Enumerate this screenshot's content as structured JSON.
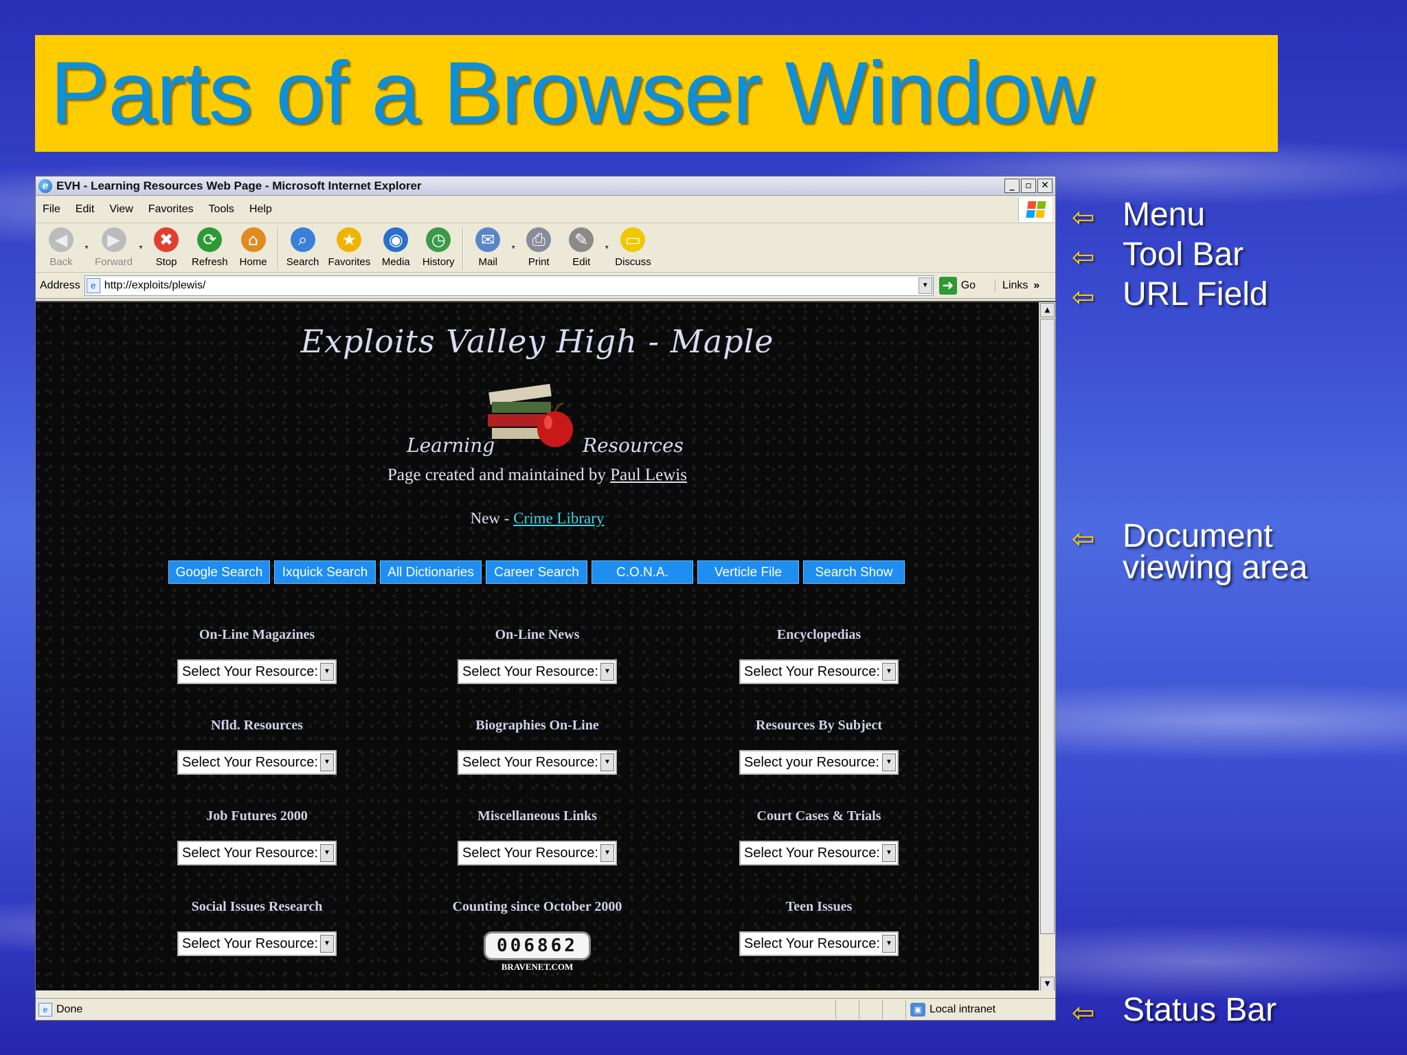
{
  "slide": {
    "title": "Parts of a Browser Window",
    "callouts": [
      {
        "label": "Menu"
      },
      {
        "label": "Tool Bar"
      },
      {
        "label": "URL Field"
      },
      {
        "label": "Document\nviewing area"
      },
      {
        "label": "Status Bar"
      }
    ]
  },
  "browser": {
    "window_title": "EVH - Learning Resources Web Page - Microsoft Internet Explorer",
    "window_buttons": [
      "_",
      "▫",
      "✕"
    ],
    "menu": [
      "File",
      "Edit",
      "View",
      "Favorites",
      "Tools",
      "Help"
    ],
    "toolbar": [
      {
        "label": "Back",
        "icon": "back-icon",
        "glyph": "◀",
        "color": "#bcbcbc",
        "disabled": true
      },
      {
        "label": "Forward",
        "icon": "forward-icon",
        "glyph": "▶",
        "color": "#bcbcbc",
        "disabled": true
      },
      {
        "label": "Stop",
        "icon": "stop-icon",
        "glyph": "✖",
        "color": "#e04030"
      },
      {
        "label": "Refresh",
        "icon": "refresh-icon",
        "glyph": "⟳",
        "color": "#2e9a36"
      },
      {
        "label": "Home",
        "icon": "home-icon",
        "glyph": "⌂",
        "color": "#e08a20"
      },
      {
        "label": "Search",
        "icon": "search-icon",
        "glyph": "⌕",
        "color": "#3b7fd8"
      },
      {
        "label": "Favorites",
        "icon": "favorites-star-icon",
        "glyph": "★",
        "color": "#f0b400"
      },
      {
        "label": "Media",
        "icon": "media-globe-icon",
        "glyph": "◉",
        "color": "#2a70c8"
      },
      {
        "label": "History",
        "icon": "history-clock-icon",
        "glyph": "◷",
        "color": "#3a9a48"
      },
      {
        "label": "Mail",
        "icon": "mail-icon",
        "glyph": "✉",
        "color": "#5a86c8"
      },
      {
        "label": "Print",
        "icon": "print-icon",
        "glyph": "⎙",
        "color": "#8a8a9a"
      },
      {
        "label": "Edit",
        "icon": "edit-icon",
        "glyph": "✎",
        "color": "#8a8a8a"
      },
      {
        "label": "Discuss",
        "icon": "discuss-icon",
        "glyph": "▭",
        "color": "#f0c800"
      }
    ],
    "address": {
      "label": "Address",
      "value": "http://exploits/plewis/",
      "go": "Go",
      "links": "Links",
      "links_chevron": "»"
    },
    "page": {
      "site_title": "Exploits Valley High - Maple",
      "logo_left": "Learning",
      "logo_right": "Resources",
      "maintained_prefix": "Page created and maintained by",
      "maintained_link": "Paul Lewis",
      "new_prefix": "New -",
      "new_link": "Crime Library",
      "nav_buttons": [
        "Google Search",
        "Ixquick Search",
        "All Dictionaries",
        "Career Search",
        "C.O.N.A.",
        "Verticle File",
        "Search Show"
      ],
      "resources": [
        {
          "label": "On-Line Magazines",
          "select": "Select Your Resource:"
        },
        {
          "label": "On-Line News",
          "select": "Select Your Resource:"
        },
        {
          "label": "Encyclopedias",
          "select": "Select Your Resource:"
        },
        {
          "label": "Nfld. Resources",
          "select": "Select Your Resource:"
        },
        {
          "label": "Biographies On-Line",
          "select": "Select Your Resource:"
        },
        {
          "label": "Resources By Subject",
          "select": "Select your Resource:"
        },
        {
          "label": "Job Futures 2000",
          "select": "Select Your Resource:"
        },
        {
          "label": "Miscellaneous Links",
          "select": "Select Your Resource:"
        },
        {
          "label": "Court Cases & Trials",
          "select": "Select Your Resource:"
        },
        {
          "label": "Social Issues Research",
          "select": "Select Your Resource:"
        },
        {
          "label": "Counting since October 2000",
          "counter": "006862",
          "counter_sub": "BRAVENET.COM"
        },
        {
          "label": "Teen Issues",
          "select": "Select Your Resource:"
        }
      ]
    },
    "status": {
      "text": "Done",
      "zone": "Local intranet"
    }
  }
}
